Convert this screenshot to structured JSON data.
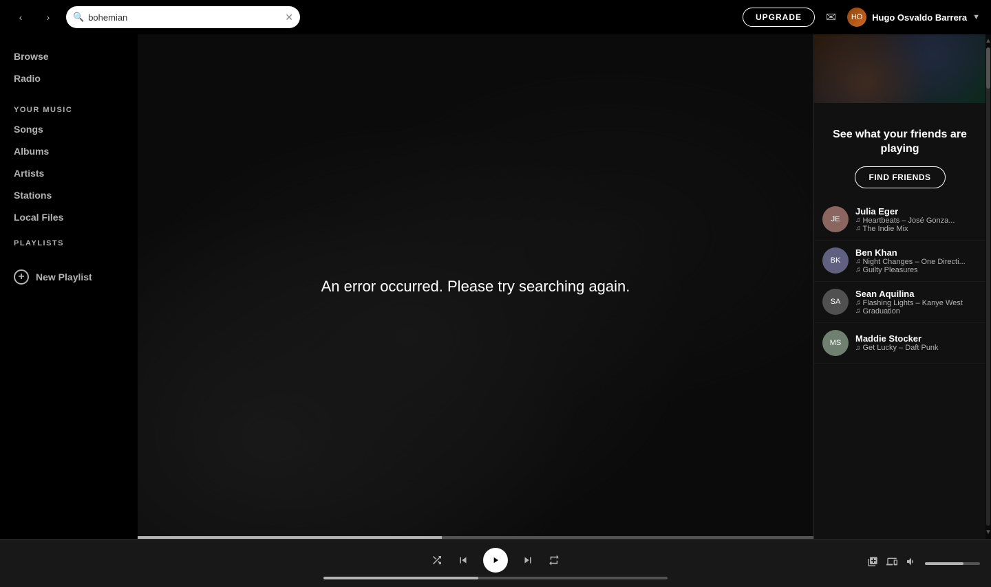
{
  "topbar": {
    "search_placeholder": "bohemian",
    "search_value": "bohemian",
    "upgrade_label": "UPGRADE",
    "user_name": "Hugo Osvaldo Barrera"
  },
  "sidebar": {
    "browse_label": "Browse",
    "radio_label": "Radio",
    "your_music_label": "YOUR MUSIC",
    "songs_label": "Songs",
    "albums_label": "Albums",
    "artists_label": "Artists",
    "stations_label": "Stations",
    "local_files_label": "Local Files",
    "playlists_label": "PLAYLISTS",
    "new_playlist_label": "New Playlist"
  },
  "content": {
    "error_message": "An error occurred. Please try searching again."
  },
  "right_panel": {
    "header": "See what your friends are playing",
    "find_friends_label": "FIND FRIENDS",
    "friends": [
      {
        "name": "Julia Eger",
        "track": "Heartbeats – José Gonza...",
        "playlist": "The Indie Mix",
        "avatar_color": "#8B6560"
      },
      {
        "name": "Ben Khan",
        "track": "Night Changes – One Directi...",
        "playlist": "Guilty Pleasures",
        "avatar_color": "#606080"
      },
      {
        "name": "Sean Aquilina",
        "track": "Flashing Lights – Kanye West",
        "playlist": "Graduation",
        "avatar_color": "#505050"
      },
      {
        "name": "Maddie Stocker",
        "track": "Get Lucky – Daft Punk",
        "playlist": "",
        "avatar_color": "#708070"
      }
    ]
  },
  "player": {
    "shuffle_label": "shuffle",
    "prev_label": "previous",
    "play_label": "play",
    "next_label": "next",
    "repeat_label": "repeat",
    "queue_label": "queue",
    "devices_label": "devices",
    "volume_label": "volume"
  }
}
